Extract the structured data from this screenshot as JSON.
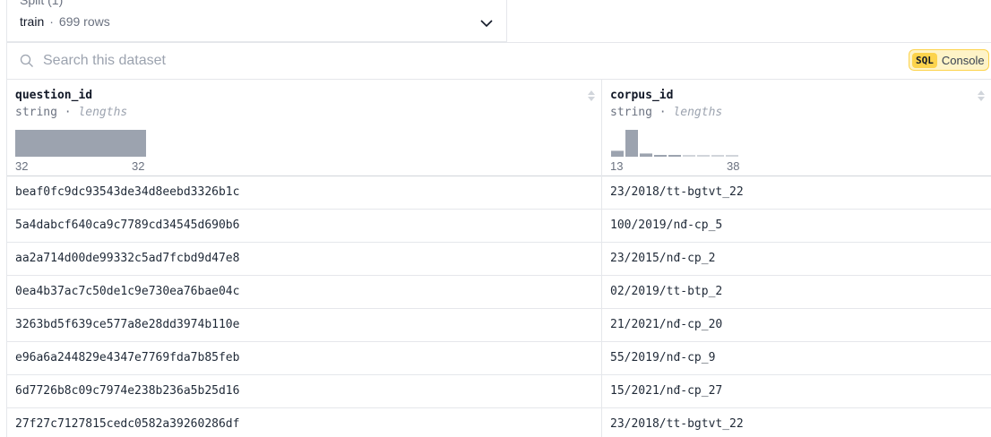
{
  "split": {
    "label": "Split (1)",
    "value": "train",
    "separator": "·",
    "rows": "699 rows"
  },
  "search": {
    "placeholder": "Search this dataset"
  },
  "sql_button": {
    "tag": "SQL",
    "label": "Console"
  },
  "columns": [
    {
      "name": "question_id",
      "type": "string",
      "sep": "·",
      "stat": "lengths",
      "hist_min": "32",
      "hist_max": "32",
      "hist_bins": [
        1.0
      ]
    },
    {
      "name": "corpus_id",
      "type": "string",
      "sep": "·",
      "stat": "lengths",
      "hist_min": "13",
      "hist_max": "38",
      "hist_bins": [
        0.22,
        1.0,
        0.12,
        0.06,
        0.06,
        0.03,
        0.04,
        0.03,
        0.03
      ]
    }
  ],
  "rows": [
    [
      "beaf0fc9dc93543de34d8eebd3326b1c",
      "23/2018/tt-bgtvt_22"
    ],
    [
      "5a4dabcf640ca9c7789cd34545d690b6",
      "100/2019/nđ-cp_5"
    ],
    [
      "aa2a714d00de99332c5ad7fcbd9d47e8",
      "23/2015/nđ-cp_2"
    ],
    [
      "0ea4b37ac7c50de1c9e730ea76bae04c",
      "02/2019/tt-btp_2"
    ],
    [
      "3263bd5f639ce577a8e28dd3974b110e",
      "21/2021/nđ-cp_20"
    ],
    [
      "e96a6a244829e4347e7769fda7b85feb",
      "55/2019/nđ-cp_9"
    ],
    [
      "6d7726b8c09c7974e238b236a5b25d16",
      "15/2021/nđ-cp_27"
    ],
    [
      "27f27c7127815cedc0582a39260286df",
      "23/2018/tt-bgtvt_22"
    ]
  ],
  "colors": {
    "hist_bar": "#9ca3af",
    "hist_bar_light": "#d1d5db",
    "sql_bg": "#fef3c7",
    "sql_tag": "#fcd34d"
  }
}
